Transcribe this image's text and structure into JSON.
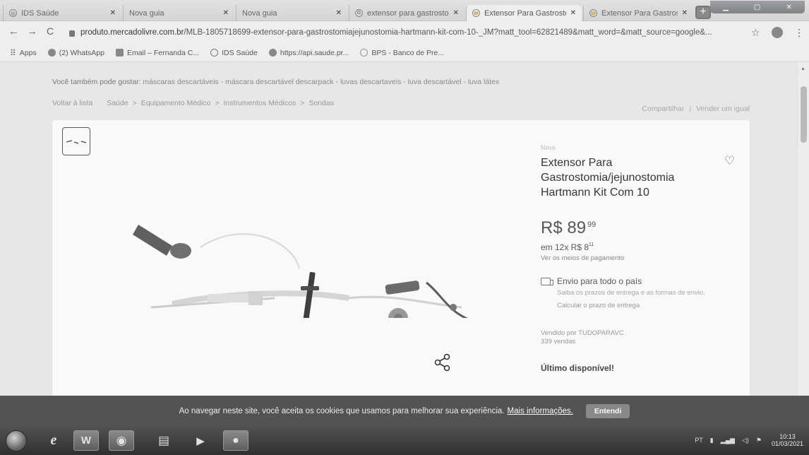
{
  "browser": {
    "tabs": [
      {
        "icon": "ids-favicon",
        "title": "IDS Saúde"
      },
      {
        "icon": "blank-favicon",
        "title": "Nova guia"
      },
      {
        "icon": "blank-favicon",
        "title": "Nova guia"
      },
      {
        "icon": "google-favicon",
        "title": "extensor para gastrosto"
      },
      {
        "icon": "mercadolivre-favicon",
        "title": "Extensor Para Gastrosto"
      },
      {
        "icon": "mercadolivre-favicon",
        "title": "Extensor Para Gastrosto"
      }
    ],
    "url_domain": "produto.mercadolivre.com.br",
    "url_path": "/MLB-1805718699-extensor-para-gastrostomiajejunostomia-hartmann-kit-com-10-_JM?matt_tool=62821489&matt_word=&matt_source=google&..."
  },
  "bookmarks": [
    {
      "icon": "apps-grid-icon",
      "label": "Apps"
    },
    {
      "icon": "whatsapp-icon",
      "label": "(2) WhatsApp"
    },
    {
      "icon": "email-icon",
      "label": "Email – Fernanda C..."
    },
    {
      "icon": "ids-icon",
      "label": "IDS Saúde"
    },
    {
      "icon": "globe-icon",
      "label": "https://api.saude.pr..."
    },
    {
      "icon": "bps-icon",
      "label": "BPS - Banco de Pre..."
    }
  ],
  "page": {
    "also_like_prefix": "Você também pode gostar:",
    "also_like_links": "máscaras descartáveis - máscara descartável descarpack - luvas descartaveis - luva descartável - luva látex",
    "breadcrumb_back": "Voltar à lista",
    "breadcrumb": [
      "Saúde",
      ">",
      "Equipamento Médico",
      ">",
      "Instrumentos Médicos",
      ">",
      "Sondas"
    ],
    "share": "Compartilhar",
    "sell_same": "Vender um igual"
  },
  "product": {
    "condition": "Novo",
    "title": "Extensor Para Gastrostomia/jejunostomia Hartmann Kit Com 10",
    "price_main": "R$ 89",
    "price_cents": "99",
    "installments_prefix": "em 12x R$ 8",
    "installments_cents": "11",
    "payment_link": "Ver os meios de pagamento",
    "shipping_title": "Envio para todo o país",
    "shipping_desc": "Saiba os prazos de entrega e as formas de envio.",
    "shipping_calc": "Calcular o prazo de entrega",
    "seller_line1": "Vendido por TUDOPARAVC",
    "seller_line2": "339 vendas",
    "stock": "Último disponível!"
  },
  "cookie_banner": {
    "text": "Ao navegar neste site, você aceita os cookies que usamos para melhorar sua experiência.",
    "more_link": "Mais informações.",
    "accept_label": "Entendi"
  },
  "taskbar": {
    "items": [
      "internet-explorer-icon",
      "word-icon",
      "chrome-icon",
      "file-explorer-icon",
      "media-player-icon",
      "paint-icon"
    ],
    "lang": "PT",
    "time": "10:13",
    "date": "01/03/2021"
  }
}
